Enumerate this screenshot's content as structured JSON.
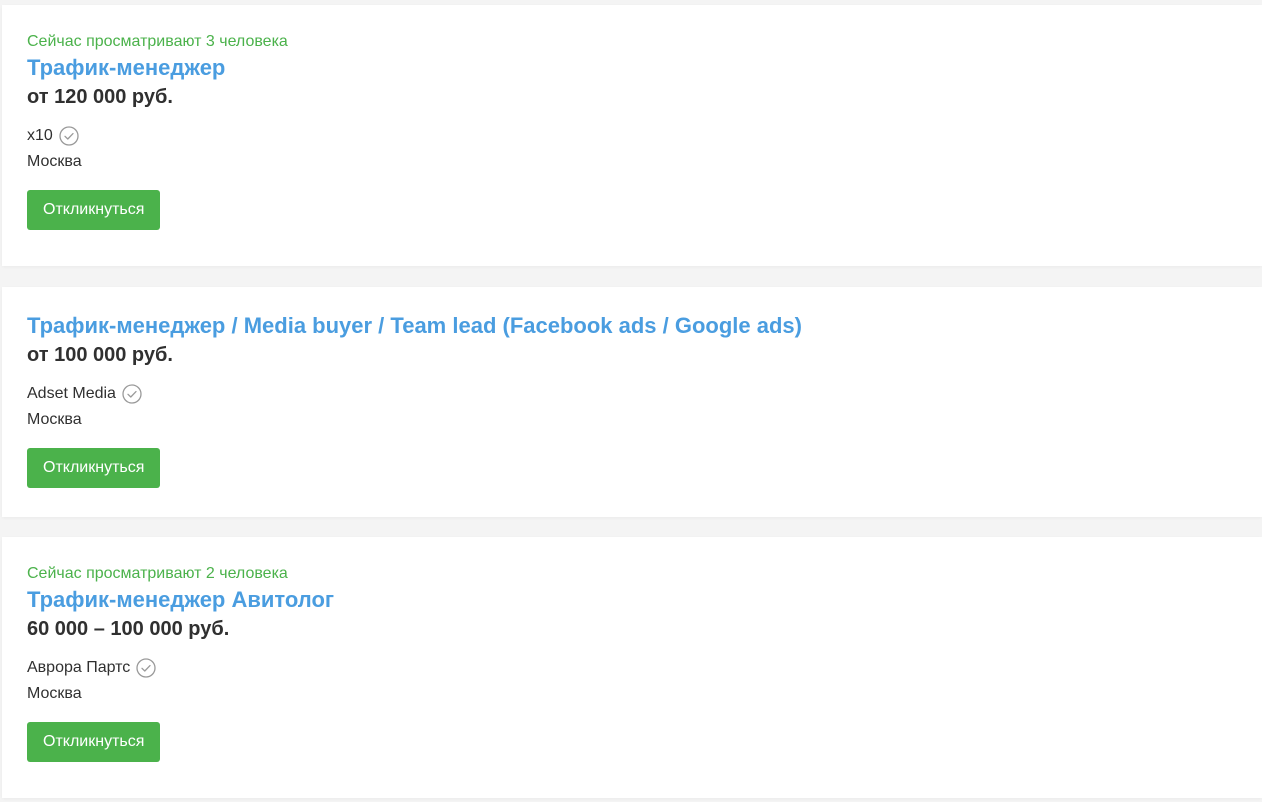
{
  "vacancies": [
    {
      "viewers": "Сейчас просматривают 3 человека",
      "title": "Трафик-менеджер",
      "salary": "от 120 000 руб.",
      "employer": "x10",
      "city": "Москва",
      "button_label": "Откликнуться",
      "verified_icon": "check-circle-icon"
    },
    {
      "viewers": "",
      "title": "Трафик-менеджер / Media buyer / Team lead (Facebook ads / Google ads)",
      "salary": "от 100 000 руб.",
      "employer": "Adset Media",
      "city": "Москва",
      "button_label": "Откликнуться",
      "verified_icon": "check-circle-icon"
    },
    {
      "viewers": "Сейчас просматривают 2 человека",
      "title": "Трафик-менеджер Авитолог",
      "salary": "60 000 – 100 000 руб.",
      "employer": "Аврора Партс",
      "city": "Москва",
      "button_label": "Откликнуться",
      "verified_icon": "check-circle-icon"
    }
  ],
  "colors": {
    "accent_green": "#4bb24b",
    "link_blue": "#4a9de0",
    "text_dark": "#303030",
    "background": "#f4f4f4"
  }
}
